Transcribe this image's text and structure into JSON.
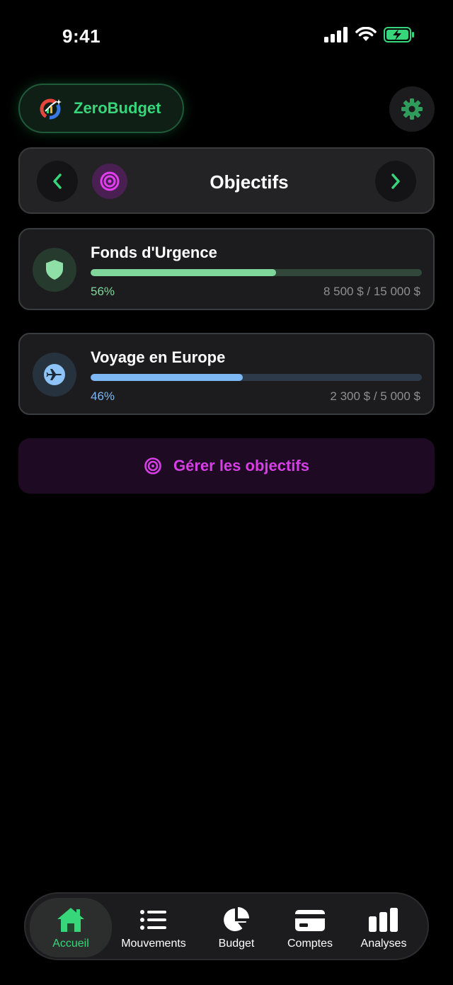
{
  "status_bar": {
    "time": "9:41",
    "icons": [
      "signal-icon",
      "wifi-icon",
      "battery-charging-icon"
    ]
  },
  "header": {
    "app_name": "ZeroBudget",
    "settings_icon": "gear-icon"
  },
  "section": {
    "title": "Objectifs",
    "icon": "target-icon"
  },
  "goals": [
    {
      "name": "Fonds d'Urgence",
      "percent_label": "56%",
      "progress": 0.56,
      "amount": "8 500 $ / 15 000 $",
      "icon": "shield-icon",
      "color": "#7fd69b",
      "track": "#30473a",
      "icon_bg": "#263a2d"
    },
    {
      "name": "Voyage en Europe",
      "percent_label": "46%",
      "progress": 0.46,
      "amount": "2 300 $ / 5 000 $",
      "icon": "airplane-icon",
      "color": "#7db8f5",
      "track": "#2c3a4a",
      "icon_bg": "#26333f"
    }
  ],
  "manage_button": {
    "label": "Gérer les objectifs"
  },
  "tabs": [
    {
      "label": "Accueil",
      "icon": "home-icon",
      "active": true
    },
    {
      "label": "Mouvements",
      "icon": "list-icon",
      "active": false
    },
    {
      "label": "Budget",
      "icon": "pie-chart-icon",
      "active": false
    },
    {
      "label": "Comptes",
      "icon": "credit-card-icon",
      "active": false
    },
    {
      "label": "Analyses",
      "icon": "bar-chart-icon",
      "active": false
    }
  ],
  "colors": {
    "accent_green": "#37d67a",
    "accent_purple": "#d63ee6"
  }
}
